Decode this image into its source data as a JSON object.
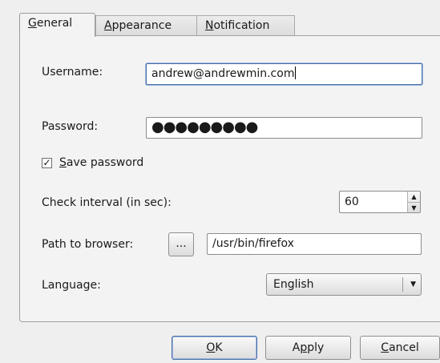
{
  "tabs": [
    {
      "pre": "",
      "key": "G",
      "post": "eneral"
    },
    {
      "pre": "",
      "key": "A",
      "post": "ppearance"
    },
    {
      "pre": "",
      "key": "N",
      "post": "otification"
    }
  ],
  "general": {
    "username_label": "Username:",
    "username_value": "andrew@andrewmin.com",
    "password_label": "Password:",
    "password_mask": "●●●●●●●●●",
    "save_password": {
      "checked": true,
      "mark": "✓",
      "key": "S",
      "rest": "ave password"
    },
    "interval_label": "Check interval (in sec):",
    "interval_value": "60",
    "path_label": "Path to browser:",
    "browse_label": "...",
    "path_value": "/usr/bin/firefox",
    "language_label": "Language:",
    "language_value": "English"
  },
  "buttons": {
    "ok": {
      "key": "O",
      "rest": "K"
    },
    "apply": {
      "pre": "A",
      "key": "p",
      "rest": "ply"
    },
    "cancel": {
      "key": "C",
      "rest": "ancel"
    }
  },
  "icons": {
    "spin_up": "▲",
    "spin_down": "▼",
    "combo_arrow": "▼"
  }
}
